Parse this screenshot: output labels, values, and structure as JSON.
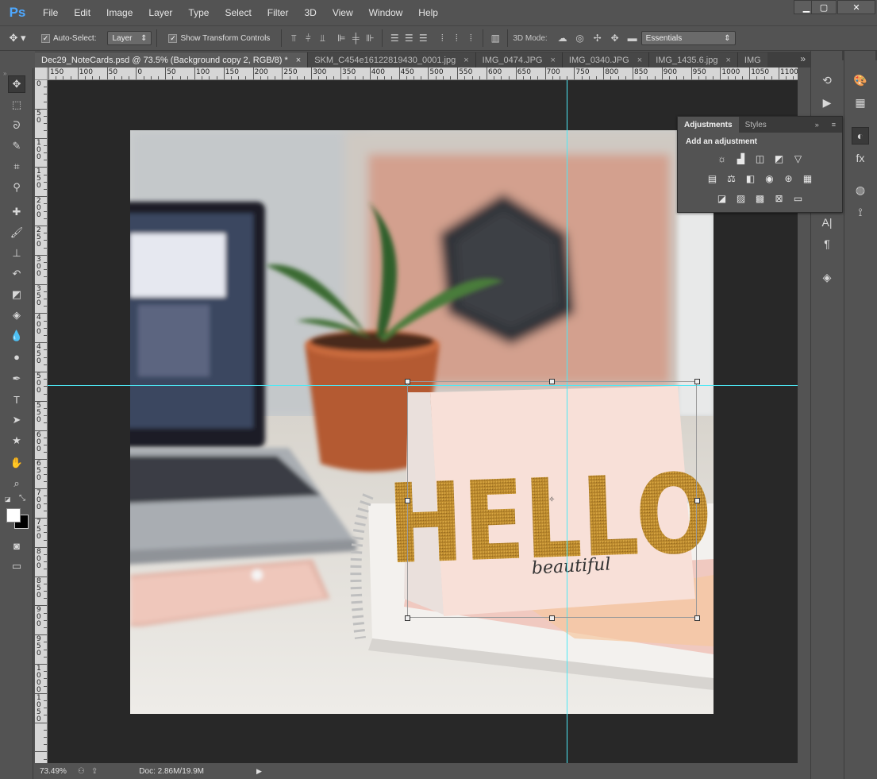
{
  "app": {
    "logo": "Ps"
  },
  "menu": [
    "File",
    "Edit",
    "Image",
    "Layer",
    "Type",
    "Select",
    "Filter",
    "3D",
    "View",
    "Window",
    "Help"
  ],
  "window_controls": {
    "minimize": "▁",
    "maximize": "▢",
    "close": "✕"
  },
  "options": {
    "tool_icon": "move-tool-icon",
    "auto_select_label": "Auto-Select:",
    "auto_select_checked": "✓",
    "auto_select_target": "Layer",
    "show_transform_label": "Show Transform Controls",
    "show_transform_checked": "✓",
    "mode_3d_label": "3D Mode:",
    "workspace": "Essentials"
  },
  "tabs": [
    {
      "label": "Dec29_NoteCards.psd @ 73.5% (Background copy 2, RGB/8) *",
      "close": "×"
    },
    {
      "label": "SKM_C454e16122819430_0001.jpg",
      "close": "×"
    },
    {
      "label": "IMG_0474.JPG",
      "close": "×"
    },
    {
      "label": "IMG_0340.JPG",
      "close": "×"
    },
    {
      "label": "IMG_1435.6.jpg",
      "close": "×"
    },
    {
      "label": "IMG",
      "close": ""
    }
  ],
  "tabs_overflow": "»",
  "ruler_top": [
    "150",
    "100",
    "50",
    "0",
    "50",
    "100",
    "150",
    "200",
    "250",
    "300",
    "350",
    "400",
    "450",
    "500",
    "550",
    "600",
    "650",
    "700",
    "750",
    "800",
    "850",
    "900",
    "950",
    "1000",
    "1050",
    "1100"
  ],
  "ruler_left": [
    "0",
    "5 0",
    "1 0 0",
    "1 5 0",
    "2 0 0",
    "2 5 0",
    "3 0 0",
    "3 5 0",
    "4 0 0",
    "4 5 0",
    "5 0 0",
    "5 5 0",
    "6 0 0",
    "6 5 0",
    "7 0 0",
    "7 5 0",
    "8 0 0",
    "8 5 0",
    "9 0 0",
    "9 5 0",
    "1 0 0 0",
    "1 0 5 0"
  ],
  "card": {
    "title": "HELLO",
    "subtitle": "beautiful"
  },
  "status": {
    "zoom": "73.49%",
    "doc": "Doc: 2.86M/19.9M",
    "arrow": "▶"
  },
  "adjustments": {
    "tab_adjustments": "Adjustments",
    "tab_styles": "Styles",
    "heading": "Add an adjustment",
    "row1": [
      "brightness-contrast-icon",
      "levels-icon",
      "curves-icon",
      "exposure-icon",
      "vibrance-icon"
    ],
    "row2": [
      "hue-saturation-icon",
      "color-balance-icon",
      "black-white-icon",
      "photo-filter-icon",
      "channel-mixer-icon",
      "color-lookup-icon"
    ],
    "row3": [
      "invert-icon",
      "posterize-icon",
      "threshold-icon",
      "selective-color-icon",
      "gradient-map-icon"
    ]
  },
  "colors": {
    "guide": "#4de8f5",
    "ps_blue": "#4ea8ff",
    "glitter_gold": "#b8862b",
    "card_pink": "#f8e0d8"
  }
}
